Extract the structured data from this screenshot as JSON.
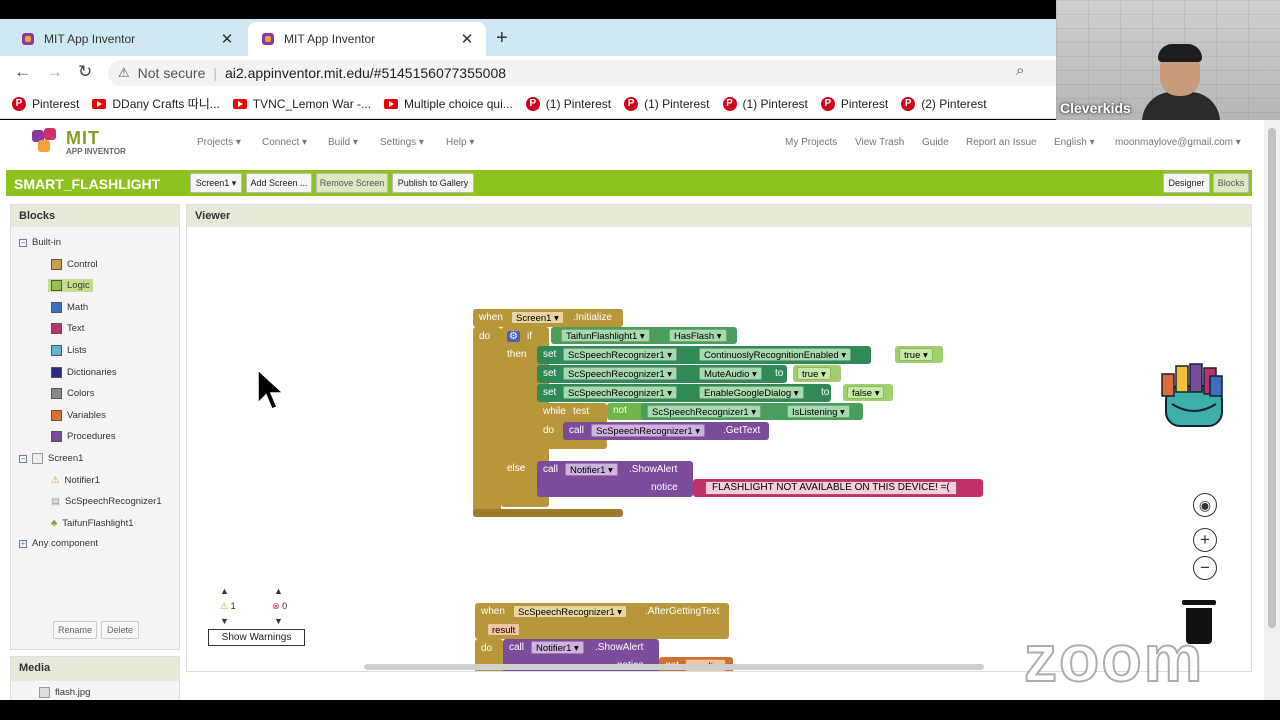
{
  "browser": {
    "tabs": [
      {
        "title": "MIT App Inventor",
        "active": false
      },
      {
        "title": "MIT App Inventor",
        "active": true
      }
    ],
    "new_tab_label": "+",
    "security_label": "Not secure",
    "url": "ai2.appinventor.mit.edu/#5145156077355008",
    "bookmarks": [
      {
        "label": "Pinterest",
        "icon": "pinterest-icon"
      },
      {
        "label": "DDany Crafts 따니...",
        "icon": "ddany-icon"
      },
      {
        "label": "TVNC_Lemon War -...",
        "icon": "youtube-icon"
      },
      {
        "label": "Multiple choice qui...",
        "icon": "youtube-icon"
      },
      {
        "label": "(1) Pinterest",
        "icon": "pinterest-icon"
      },
      {
        "label": "(1) Pinterest",
        "icon": "pinterest-icon"
      },
      {
        "label": "(1) Pinterest",
        "icon": "pinterest-icon"
      },
      {
        "label": "Pinterest",
        "icon": "pinterest-icon"
      },
      {
        "label": "(2) Pinterest",
        "icon": "pinterest-icon"
      }
    ]
  },
  "webcam": {
    "name": "Cleverkids"
  },
  "app": {
    "logo_mit": "MIT",
    "logo_sub": "APP INVENTOR",
    "menu": [
      "Projects ▾",
      "Connect ▾",
      "Build ▾",
      "Settings ▾",
      "Help ▾"
    ],
    "right_menu": [
      "My Projects",
      "View Trash",
      "Guide",
      "Report an Issue",
      "English ▾",
      "moonmaylove@gmail.com ▾"
    ],
    "project_name": "SMART_FLASHLIGHT",
    "toolbar": {
      "screen": "Screen1 ▾",
      "add_screen": "Add Screen ...",
      "remove_screen": "Remove Screen",
      "publish": "Publish to Gallery",
      "designer": "Designer",
      "blocks": "Blocks"
    },
    "blocks_panel": {
      "title": "Blocks",
      "builtin": "Built-in",
      "items": [
        {
          "label": "Control",
          "color": "#c8a24a"
        },
        {
          "label": "Logic",
          "color": "#8fc35a"
        },
        {
          "label": "Math",
          "color": "#3a6fc4"
        },
        {
          "label": "Text",
          "color": "#c0306a"
        },
        {
          "label": "Lists",
          "color": "#58b4d8"
        },
        {
          "label": "Dictionaries",
          "color": "#2a2a8a"
        },
        {
          "label": "Colors",
          "color": "#8a8a8a"
        },
        {
          "label": "Variables",
          "color": "#e07030"
        },
        {
          "label": "Procedures",
          "color": "#7a4c9a"
        }
      ],
      "screen": "Screen1",
      "components": [
        "Notifier1",
        "ScSpeechRecognizer1",
        "TaifunFlashlight1"
      ],
      "any_component": "Any component",
      "rename": "Rename",
      "delete": "Delete"
    },
    "media_panel": {
      "title": "Media",
      "item": "flash.jpg"
    },
    "viewer": {
      "title": "Viewer",
      "block1": {
        "when": "when",
        "component": "Screen1 ▾",
        "event": ".Initialize",
        "do": "do",
        "if": "if",
        "flash_comp": "TaifunFlashlight1 ▾",
        "has_flash": "HasFlash ▾",
        "then": "then",
        "set1_comp": "ScSpeechRecognizer1 ▾",
        "set1_prop": "ContinuoslyRecognitionEnabled ▾",
        "set1_val": "true ▾",
        "set2_comp": "ScSpeechRecognizer1 ▾",
        "set2_prop": "MuteAudio ▾",
        "set2_val": "true ▾",
        "set3_comp": "ScSpeechRecognizer1 ▾",
        "set3_prop": "EnableGoogleDialog ▾",
        "set3_val": "false ▾",
        "set_word": "set",
        "to_word": "to",
        "while": "while",
        "test": "test",
        "not": "not",
        "while_comp": "ScSpeechRecognizer1 ▾",
        "while_prop": "IsListening ▾",
        "call": "call",
        "gettext_comp": "ScSpeechRecognizer1 ▾",
        "gettext": ".GetText",
        "else": "else",
        "notifier_comp": "Notifier1 ▾",
        "show_alert": ".ShowAlert",
        "notice": "notice",
        "alert_text": "FLASHLIGHT NOT AVAILABLE ON THIS DEVICE! =("
      },
      "block2": {
        "when": "when",
        "component": "ScSpeechRecognizer1 ▾",
        "event": ".AfterGettingText",
        "param": "result",
        "do": "do",
        "call": "call",
        "notifier_comp": "Notifier1 ▾",
        "show_alert": ".ShowAlert",
        "notice": "notice",
        "get": "get",
        "result": "result ▾"
      },
      "warnings": {
        "warn_count": "1",
        "error_count": "0",
        "show_warnings": "Show Warnings"
      }
    }
  },
  "watermark": "zoom"
}
